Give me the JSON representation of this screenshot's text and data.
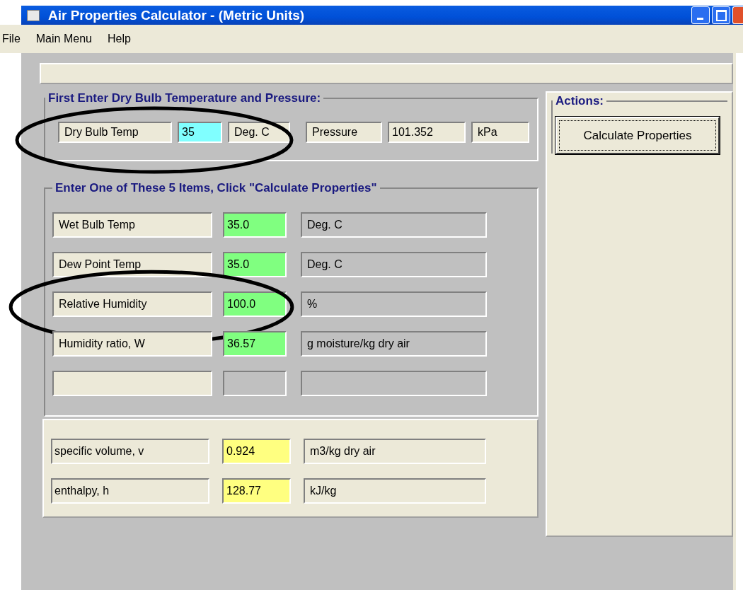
{
  "window": {
    "title": "Air Properties Calculator - (Metric Units)"
  },
  "menu": [
    {
      "label": "File"
    },
    {
      "label": "Main Menu"
    },
    {
      "label": "Help"
    }
  ],
  "inputs": {
    "title": "First Enter Dry Bulb Temperature and Pressure:",
    "clusters": [
      {
        "circled": true,
        "label": "Dry Bulb Temp",
        "value": "35",
        "color": "#80ffff",
        "unit": "Deg. C"
      },
      {
        "circled": false,
        "label": "Pressure",
        "value": "101.352",
        "color": "#ece9d8",
        "unit": "kPa"
      }
    ]
  },
  "items": {
    "title": "Enter One of These 5 Items, Click \"Calculate Properties\"",
    "rows": [
      {
        "circled": false,
        "label": "Wet Bulb Temp",
        "value": "35.0",
        "color": "#80ff80",
        "unit": "Deg. C"
      },
      {
        "circled": false,
        "label": "Dew Point Temp",
        "value": "35.0",
        "color": "#80ff80",
        "unit": "Deg. C"
      },
      {
        "circled": true,
        "label": "Relative Humidity",
        "value": "100.0",
        "color": "#80ff80",
        "unit": "%"
      },
      {
        "circled": false,
        "label": "Humidity ratio, W",
        "value": "36.57",
        "color": "#80ff80",
        "unit": "g moisture/kg dry air"
      },
      {
        "circled": false,
        "label": "",
        "value": "",
        "color": "#c0c0c0",
        "unit": ""
      }
    ]
  },
  "results": [
    {
      "label": "specific volume, v",
      "value": "0.924",
      "color": "#ffff80",
      "unit": "m3/kg dry air"
    },
    {
      "label": "enthalpy, h",
      "value": "128.77",
      "color": "#ffff80",
      "unit": "kJ/kg"
    }
  ],
  "actions": {
    "title": "Actions:",
    "button": "Calculate Properties"
  }
}
